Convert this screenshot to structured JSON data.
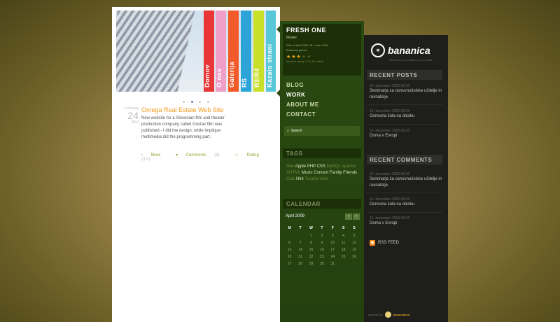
{
  "hero": {
    "banners": [
      "Domov",
      "O nas",
      "Galerija",
      "RS",
      "R3/R4",
      "Kazalo strani"
    ],
    "colors": [
      "#2ca4d8",
      "#e83535",
      "#f0a0c8",
      "#f25a2a",
      "#2ca4d8",
      "#c8e02a",
      "#58c8d8"
    ]
  },
  "post": {
    "month": "February",
    "day": "24",
    "year": "2007",
    "title": "Omega Real Estate Web Site",
    "body": "New website for a Slovenian film and theater production company called Gustav film was published - I did the design, while Implique multimedia did the programming part.",
    "more": "More",
    "comments": "Comments",
    "comments_count": "(4)",
    "rating": "Rating",
    "rating_value": "(3.0)"
  },
  "feature": {
    "title": "FRESH ONE",
    "subtitle": "Flower",
    "meta": "26th of April 2006, St. Louis, USA",
    "location": "Botanical garden",
    "stars": "★★★",
    "stars_off": "★★",
    "rating_text": "(current rating: 3.4 | 15 votes)"
  },
  "menu": [
    "BLOG",
    "WORK",
    "ABOUT ME",
    "CONTACT"
  ],
  "search": {
    "label": "Search"
  },
  "tags": {
    "heading": "TAGS",
    "items": [
      {
        "t": "Mac",
        "h": false
      },
      {
        "t": "Apple",
        "h": true
      },
      {
        "t": "PHP",
        "h": true
      },
      {
        "t": "CSS",
        "h": true
      },
      {
        "t": "MySQL",
        "h": false
      },
      {
        "t": "Apache",
        "h": false
      },
      {
        "t": "XHTML",
        "h": false
      },
      {
        "t": "Music",
        "h": true
      },
      {
        "t": "Concert",
        "h": true
      },
      {
        "t": "Family",
        "h": true
      },
      {
        "t": "Friends",
        "h": true
      },
      {
        "t": "Cats",
        "h": false
      },
      {
        "t": "Hint",
        "h": true
      },
      {
        "t": "Tutorial",
        "h": false
      },
      {
        "t": "Unix",
        "h": false
      }
    ]
  },
  "calendar": {
    "heading": "CALENDAR",
    "month": "April 2009",
    "prev": "‹",
    "next": "›",
    "days": [
      "M",
      "T",
      "W",
      "T",
      "F",
      "S",
      "S"
    ],
    "weeks": [
      [
        "",
        "",
        "1",
        "2",
        "3",
        "4",
        "5"
      ],
      [
        "6",
        "7",
        "8",
        "9",
        "10",
        "11",
        "12"
      ],
      [
        "13",
        "14",
        "15",
        "16",
        "17",
        "18",
        "19"
      ],
      [
        "20",
        "21",
        "22",
        "23",
        "24",
        "25",
        "26"
      ],
      [
        "27",
        "28",
        "29",
        "30",
        "31",
        "",
        ""
      ]
    ]
  },
  "sidebar": {
    "logo_text": "bananica",
    "logo_mark": "✶",
    "logo_tag": "BANANICA ALA FRESH PICS OF WEB",
    "recent_posts_heading": "RECENT POSTS",
    "recent_posts": [
      {
        "date": "16. december 2009 08:18",
        "title": "Seminarja za osnovnošolske učitelje in ravnatelje"
      },
      {
        "date": "16. december 2009 08:18",
        "title": "Osnovna šola na obisku"
      },
      {
        "date": "16. december 2009 08:18",
        "title": "Doma v Evropi"
      }
    ],
    "recent_comments_heading": "RECENT COMMENTS",
    "recent_comments": [
      {
        "date": "16. december 2009 08:18",
        "title": "Seminarja za osnovnošolske učitelje in ravnatelje"
      },
      {
        "date": "16. december 2009 08:18",
        "title": "Osnovna šola na obisku"
      },
      {
        "date": "16. december 2009 08:18",
        "title": "Doma v Evropi"
      }
    ],
    "rss": "RSS FEED",
    "powered_by": "powered by",
    "powered_brand": "bananadmin"
  }
}
